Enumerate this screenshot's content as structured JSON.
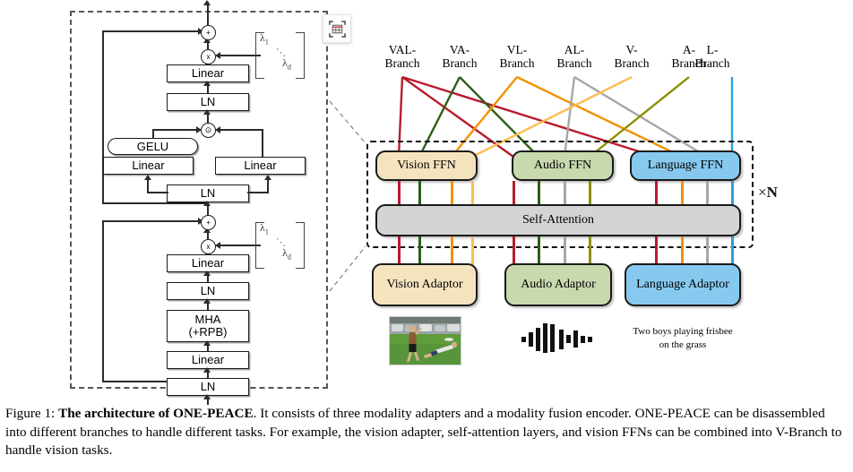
{
  "figure": {
    "caption_prefix": "Figure 1:",
    "caption_bold": "The architecture of ONE-PEACE",
    "caption_rest": ". It consists of three modality adapters and a modality fusion encoder. ONE-PEACE can be disassembled into different branches to handle different tasks. For example, the vision adapter, self-attention layers, and vision FFNs can be combined into V-Branch to handle vision tasks."
  },
  "toolbar": {
    "detect_table_icon": "table-detect-icon"
  },
  "left_panel": {
    "title": "expanded-transformer-block",
    "ffn_sublayer": {
      "linear_out": "Linear",
      "ln_out": "LN",
      "gelu": "GELU",
      "linear_left": "Linear",
      "linear_right": "Linear",
      "ln_in": "LN",
      "add_op": "+",
      "mul_op": "x",
      "gate_op": "⊙",
      "scale_first": "λ",
      "scale_first_sub": "1",
      "scale_last": "λ",
      "scale_last_sub": "d"
    },
    "attn_sublayer": {
      "linear_out": "Linear",
      "ln_out": "LN",
      "mha_line1": "MHA",
      "mha_line2": "(+RPB)",
      "linear_in": "Linear",
      "ln_in": "LN",
      "add_op": "+",
      "mul_op": "x",
      "scale_first": "λ",
      "scale_first_sub": "1",
      "scale_last": "λ",
      "scale_last_sub": "d"
    }
  },
  "architecture": {
    "branches": [
      {
        "line1": "VAL-",
        "line2": "Branch",
        "color": "#b81c2e"
      },
      {
        "line1": "VA-",
        "line2": "Branch",
        "color": "#2c6016"
      },
      {
        "line1": "VL-",
        "line2": "Branch",
        "color": "#f29100"
      },
      {
        "line1": "AL-",
        "line2": "Branch",
        "color": "#a6a6a6"
      },
      {
        "line1": "V-",
        "line2": "Branch",
        "color": "#fbbe54"
      },
      {
        "line1": "A-",
        "line2": "Branch",
        "color": "#8c9000"
      },
      {
        "line1": "L-",
        "line2": "Branch",
        "color": "#2a9fe0"
      }
    ],
    "repeat_label_prefix": "×",
    "repeat_label_value": "N",
    "ffns": [
      {
        "label": "Vision FFN",
        "fill": "#f4e3bf",
        "border": "#1a1a1a"
      },
      {
        "label": "Audio FFN",
        "fill": "#c8d9ae",
        "border": "#1a1a1a"
      },
      {
        "label": "Language FFN",
        "fill": "#87c9ee",
        "border": "#1a1a1a"
      }
    ],
    "self_attention": {
      "label": "Self-Attention",
      "fill": "#d4d4d4"
    },
    "adaptors": [
      {
        "label": "Vision Adaptor",
        "fill": "#f4e3bf"
      },
      {
        "label": "Audio Adaptor",
        "fill": "#c8d9ae"
      },
      {
        "label": "Language Adaptor",
        "fill": "#87c9ee"
      }
    ],
    "inputs": {
      "vision": "frisbee-photo-thumbnail",
      "audio": "audio-waveform-icon",
      "text_line1": "Two boys playing frisbee",
      "text_line2": "on the grass"
    },
    "ffn_port_colors": {
      "vision": [
        "#b81c2e",
        "#2c6016",
        "#f29100",
        "#fbbe54"
      ],
      "audio": [
        "#b81c2e",
        "#2c6016",
        "#a6a6a6",
        "#8c9000"
      ],
      "language": [
        "#b81c2e",
        "#f29100",
        "#a6a6a6",
        "#2a9fe0"
      ]
    }
  },
  "colors": {
    "val": "#b81c2e",
    "va": "#2c6016",
    "vl": "#f29100",
    "al": "#a6a6a6",
    "v": "#fbbe54",
    "a": "#8c9000",
    "l": "#2a9fe0",
    "panel_border": "#555555",
    "box_border": "#1a1a1a"
  }
}
